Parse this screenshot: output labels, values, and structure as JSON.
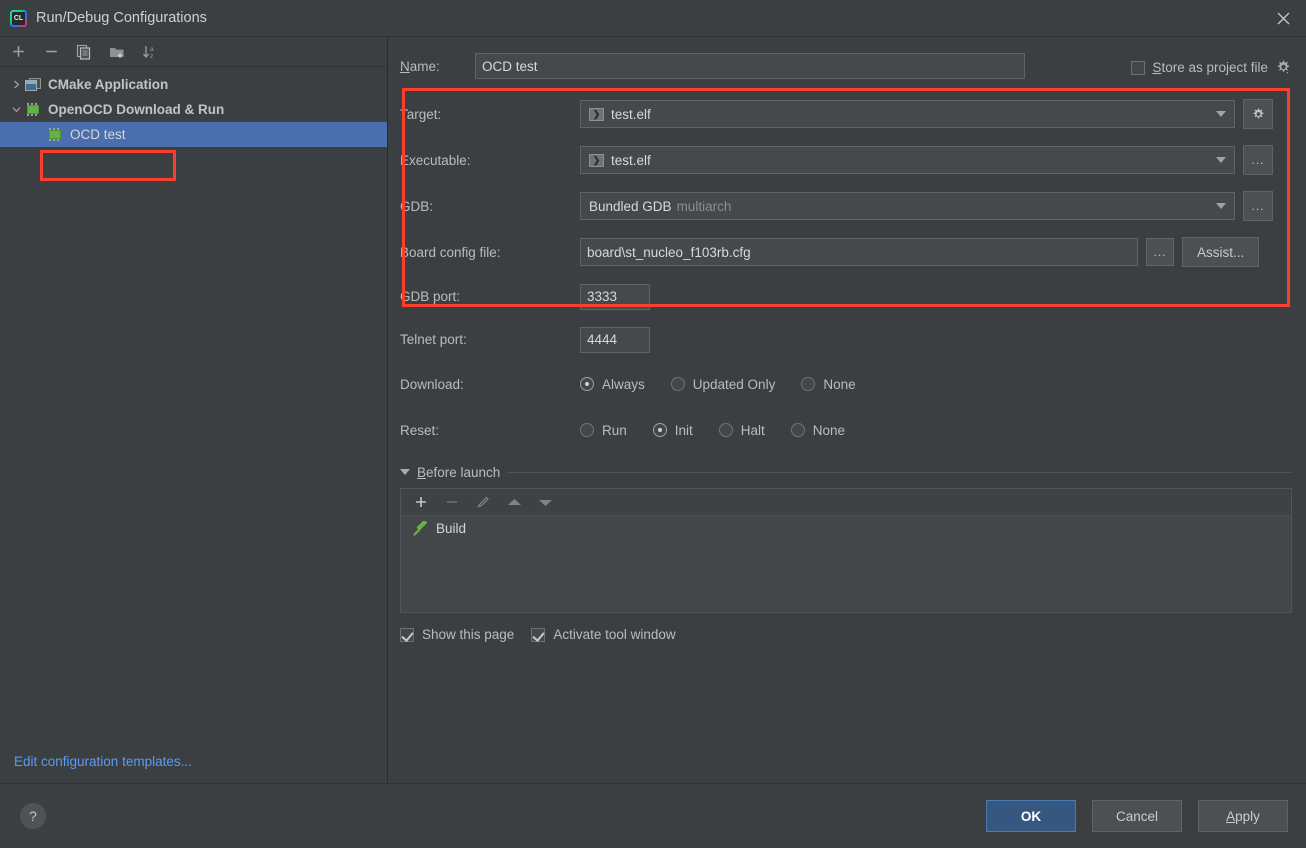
{
  "window": {
    "title": "Run/Debug Configurations",
    "logo_text": "CL",
    "close_icon": "close-icon"
  },
  "sidebar": {
    "toolbar": [
      {
        "name": "add-configuration-button",
        "icon": "plus-icon",
        "label": "+"
      },
      {
        "name": "remove-configuration-button",
        "icon": "minus-icon",
        "label": "−"
      },
      {
        "name": "copy-configuration-button",
        "icon": "copy-icon",
        "label": "copy"
      },
      {
        "name": "save-configuration-button",
        "icon": "folder-add-icon",
        "label": "folder"
      },
      {
        "name": "sort-configurations-button",
        "icon": "sort-alphabetical-icon",
        "label": "sort"
      }
    ],
    "tree": [
      {
        "label": "CMake Application",
        "icon": "cmake-application-icon",
        "expanded": false,
        "selected": false,
        "level": 0
      },
      {
        "label": "OpenOCD Download & Run",
        "icon": "microchip-icon",
        "expanded": true,
        "selected": false,
        "level": 0
      },
      {
        "label": "OCD test",
        "icon": "microchip-icon",
        "expanded": null,
        "selected": true,
        "level": 1
      }
    ],
    "edit_templates_link": "Edit configuration templates..."
  },
  "form": {
    "name_label": "Name:",
    "name_label_mnemonic": "N",
    "name_label_rest": "ame:",
    "name_value": "OCD test",
    "store_as_project_file": {
      "label_mnemonic": "S",
      "label_rest": "tore as project file",
      "label": "Store as project file",
      "checked": false,
      "gear_icon": "gear-dropdown-icon"
    },
    "fields": {
      "target": {
        "label": "Target:",
        "value": "test.elf",
        "icon": "executable-icon",
        "button": {
          "label": "gear",
          "icon": "gear-icon",
          "name": "target-settings-button"
        }
      },
      "executable": {
        "label": "Executable:",
        "value": "test.elf",
        "icon": "executable-icon",
        "button": {
          "label": "...",
          "name": "executable-browse-button"
        }
      },
      "gdb": {
        "label": "GDB:",
        "value": "Bundled GDB",
        "value_suffix": "multiarch",
        "button": {
          "label": "...",
          "name": "gdb-browse-button"
        }
      },
      "board_config": {
        "label": "Board config file:",
        "value": "board\\st_nucleo_f103rb.cfg",
        "browse_button": "...",
        "assist_button": "Assist..."
      },
      "gdb_port": {
        "label": "GDB port:",
        "value": "3333"
      },
      "telnet_port": {
        "label": "Telnet port:",
        "value": "4444"
      }
    },
    "download": {
      "label": "Download:",
      "options": [
        {
          "label": "Always",
          "selected": true
        },
        {
          "label": "Updated Only",
          "selected": false
        },
        {
          "label": "None",
          "selected": false
        }
      ]
    },
    "reset": {
      "label": "Reset:",
      "options": [
        {
          "label": "Run",
          "selected": false
        },
        {
          "label": "Init",
          "selected": true
        },
        {
          "label": "Halt",
          "selected": false
        },
        {
          "label": "None",
          "selected": false
        }
      ]
    },
    "before_launch": {
      "title": "Before launch",
      "title_mnemonic": "B",
      "title_rest": "efore launch",
      "expanded": true,
      "toolbar": [
        {
          "name": "add-task-button",
          "icon": "plus-icon",
          "label": "+",
          "enabled": true
        },
        {
          "name": "remove-task-button",
          "icon": "minus-icon",
          "label": "−",
          "enabled": false
        },
        {
          "name": "edit-task-button",
          "icon": "pencil-icon",
          "label": "edit",
          "enabled": false
        },
        {
          "name": "move-task-up-button",
          "icon": "arrow-up-icon",
          "label": "up",
          "enabled": false
        },
        {
          "name": "move-task-down-button",
          "icon": "arrow-down-icon",
          "label": "down",
          "enabled": false
        }
      ],
      "tasks": [
        {
          "label": "Build",
          "icon": "hammer-icon"
        }
      ]
    },
    "show_this_page": {
      "label": "Show this page",
      "checked": true
    },
    "activate_tool_window": {
      "label": "Activate tool window",
      "checked": true
    }
  },
  "footer": {
    "help_label": "?",
    "ok": "OK",
    "cancel": "Cancel",
    "apply_mnemonic": "A",
    "apply_rest": "pply",
    "apply": "Apply"
  },
  "colors": {
    "background": "#3c3f41",
    "selection_blue": "#4b6eaf",
    "highlight_red": "#f8402c",
    "link_blue": "#589df6",
    "primary_button": "#365880",
    "accent_green": "#62b543"
  }
}
